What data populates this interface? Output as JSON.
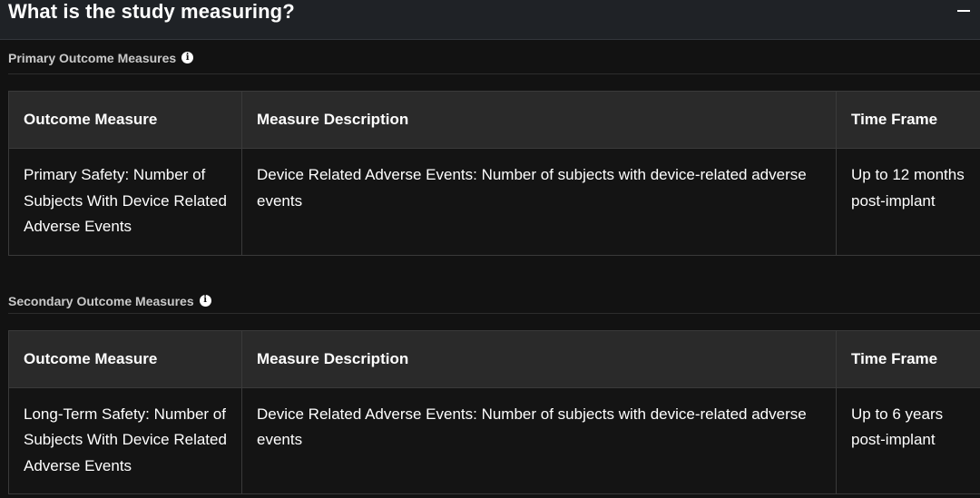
{
  "section": {
    "title": "What is the study measuring?",
    "collapse_symbol": "−"
  },
  "primary": {
    "label": "Primary Outcome Measures",
    "info_glyph": "i",
    "columns": [
      "Outcome Measure",
      "Measure Description",
      "Time Frame"
    ],
    "rows": [
      {
        "measure": "Primary Safety: Number of Subjects With Device Related Adverse Events",
        "description": "Device Related Adverse Events: Number of subjects with device-related adverse events",
        "time_frame": "Up to 12 months post-implant"
      }
    ]
  },
  "secondary": {
    "label": "Secondary Outcome Measures",
    "info_glyph": "i",
    "columns": [
      "Outcome Measure",
      "Measure Description",
      "Time Frame"
    ],
    "rows": [
      {
        "measure": "Long-Term Safety: Number of Subjects With Device Related Adverse Events",
        "description": "Device Related Adverse Events: Number of subjects with device-related adverse events",
        "time_frame": "Up to 6 years post-implant"
      }
    ]
  },
  "colors": {
    "page_background": "#121212",
    "header_background": "#1f2226",
    "table_header_background": "#2a2a2a",
    "text": "#ffffff"
  }
}
